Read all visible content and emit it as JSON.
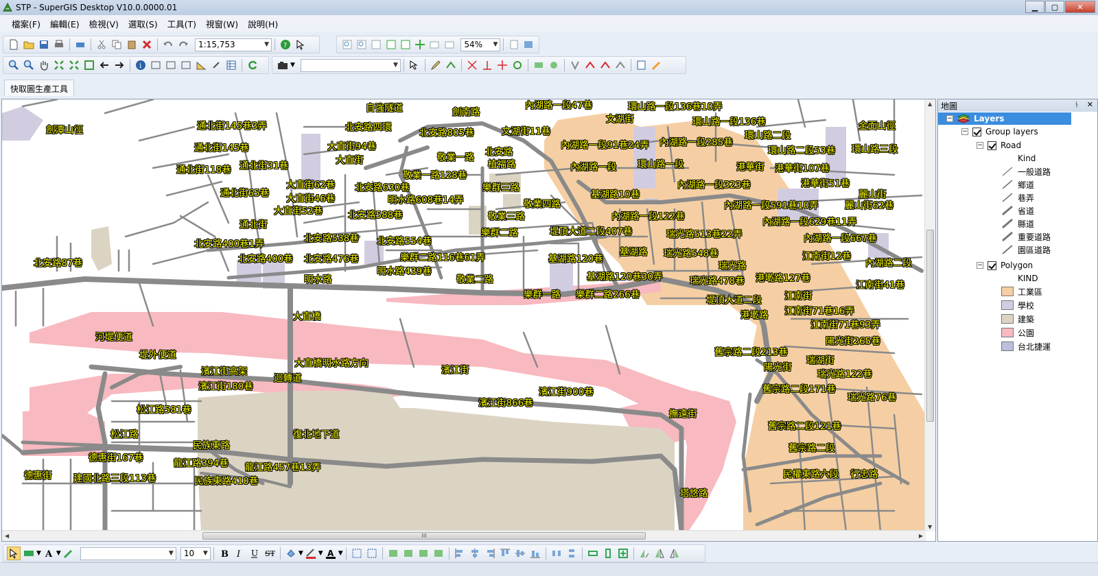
{
  "window": {
    "title": "STP - SuperGIS Desktop V10.0.0000.01",
    "minimize": "▁",
    "maximize": "▢",
    "close": "✕"
  },
  "menu": [
    "檔案(F)",
    "編輯(E)",
    "檢視(V)",
    "選取(S)",
    "工具(T)",
    "視窗(W)",
    "說明(H)"
  ],
  "toolbar": {
    "scale": "1:15,753",
    "zoom": "54%",
    "font_size": "10",
    "font_name": "",
    "layer_combo": ""
  },
  "tab": {
    "label": "快取圖生產工具"
  },
  "panel": {
    "title": "地圖",
    "pin": "ᅟ⊓",
    "close": "✕",
    "root": "Layers",
    "group": "Group layers",
    "road_layer": "Road",
    "road_kind": "Kind",
    "road_classes": [
      "一般道路",
      "鄉道",
      "巷弄",
      "省道",
      "縣道",
      "重要道路",
      "園區道路"
    ],
    "polygon_layer": "Polygon",
    "polygon_kind": "KIND",
    "polygon_classes": [
      {
        "label": "工業區",
        "color": "#f5cfa3"
      },
      {
        "label": "學校",
        "color": "#d2cce0"
      },
      {
        "label": "建築",
        "color": "#dcd4c3"
      },
      {
        "label": "公園",
        "color": "#f8b9c0"
      },
      {
        "label": "台北捷運",
        "color": "#b9bfdc"
      }
    ]
  },
  "map": {
    "colors": {
      "industrial": "#f5cfa3",
      "school": "#d2cce0",
      "building": "#dcd4c3",
      "park": "#f8b9c0",
      "mrt": "#b9bfdc",
      "road": "#8a8a8a",
      "label": "#f8f800"
    },
    "labels": [
      "自強隧道",
      "劍南路",
      "內湖路一段47巷",
      "環山路一段136巷10弄",
      "文湖街",
      "金面山徑",
      "劍潭山徑",
      "通北街145巷3弄",
      "北安路四環",
      "北安路805巷",
      "文湖街11巷",
      "環山路一段136巷",
      "環山路二段",
      "通北街145巷",
      "大直街94巷",
      "北安路",
      "內湖路一段91巷24弄",
      "內湖路一段285巷",
      "環山路二段53巷",
      "環山路三段",
      "大直街",
      "敬業一路",
      "植福路",
      "內湖路一段",
      "環山路一段",
      "港華街",
      "港華街107巷",
      "通北街118巷",
      "通北街31巷",
      "敬業一路128巷",
      "大直街62巷",
      "北安路630巷",
      "樂群三路",
      "內湖路一段323巷",
      "港華街51巷",
      "麗山街",
      "通北街65巷",
      "大直街46巷",
      "明水路608巷14弄",
      "敬業四路",
      "基湖路10巷",
      "內湖路一段591巷10弄",
      "麗山街62巷",
      "大直街52巷",
      "北安路588巷",
      "敬業三路",
      "內湖路一段122巷",
      "內湖路一段629巷11弄",
      "通北街",
      "樂群二路",
      "堤頂大道二段407巷",
      "瑞光路513巷22弄",
      "北安路538巷",
      "北安路554巷",
      "內湖路一段667巷",
      "北安路400巷1弄",
      "基湖路",
      "瑞光路548巷",
      "北安路87巷",
      "北安路400巷",
      "北安路476巷",
      "樂群二路116巷61弄",
      "基湖路120巷",
      "江南街12巷",
      "內湖路二段",
      "瑞光路",
      "明水路439巷",
      "明水路",
      "基湖路120巷30弄",
      "瑞光路478巷",
      "港墘路127巷",
      "敬業二路",
      "江南街41巷",
      "樂群一路",
      "樂群二路266巷",
      "江南街",
      "堤頂大道二段",
      "大直橋",
      "港墘路",
      "江南街71巷16弄",
      "江南街71巷93弄",
      "河堤便道",
      "陽光街265巷",
      "堤外便道",
      "舊宗路二段213巷",
      "瑞湖街",
      "大直橋明水路方向",
      "陽光街",
      "濱江街高架",
      "濱江街",
      "瑞光路122巷",
      "迴轉道",
      "濱江街180巷",
      "舊宗路二段171巷",
      "濱江街900巷",
      "瑞光路76巷",
      "濱江街866巷",
      "松江路581巷",
      "撫遠街",
      "舊宗路二段121巷",
      "松江路",
      "復北地下道",
      "民族東路",
      "舊宗路二段",
      "德惠街167巷",
      "龍江路394巷",
      "龍江路457巷13弄",
      "民權東路六段",
      "行忠路",
      "德惠街",
      "建國北路三段113巷",
      "民族東路410巷",
      "塔悠路"
    ]
  },
  "scrollbar": {
    "grip": "III"
  }
}
